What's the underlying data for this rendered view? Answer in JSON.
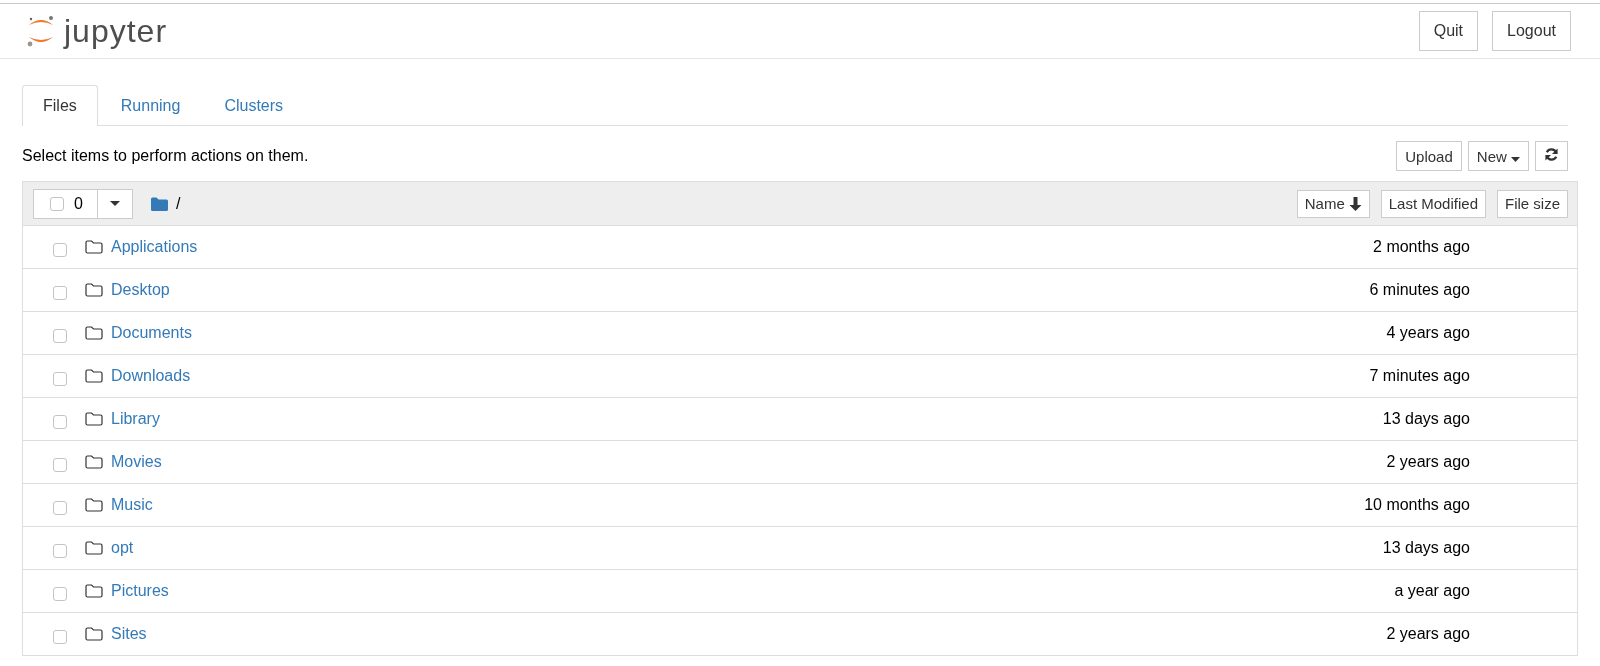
{
  "header": {
    "logo_text": "jupyter",
    "buttons": [
      "Quit",
      "Logout"
    ]
  },
  "tabs": [
    {
      "label": "Files",
      "selected": true
    },
    {
      "label": "Running",
      "selected": false
    },
    {
      "label": "Clusters",
      "selected": false
    }
  ],
  "toolbar": {
    "hint": "Select items to perform actions on them.",
    "buttons": [
      {
        "kind": "text",
        "label": "Upload"
      },
      {
        "kind": "dropdown",
        "label": "New"
      },
      {
        "kind": "refresh"
      }
    ]
  },
  "list_header": {
    "select_all_checked": false,
    "selected_count": "0",
    "path": "/",
    "sort_buttons": [
      {
        "label": "Name",
        "sorted": true
      },
      {
        "label": "Last Modified",
        "sorted": false
      },
      {
        "label": "File size",
        "sorted": false
      }
    ]
  },
  "rows": [
    {
      "name": "Applications",
      "modified": "2 months ago",
      "checked": false
    },
    {
      "name": "Desktop",
      "modified": "6 minutes ago",
      "checked": false
    },
    {
      "name": "Documents",
      "modified": "4 years ago",
      "checked": false
    },
    {
      "name": "Downloads",
      "modified": "7 minutes ago",
      "checked": false
    },
    {
      "name": "Library",
      "modified": "13 days ago",
      "checked": false
    },
    {
      "name": "Movies",
      "modified": "2 years ago",
      "checked": false
    },
    {
      "name": "Music",
      "modified": "10 months ago",
      "checked": false
    },
    {
      "name": "opt",
      "modified": "13 days ago",
      "checked": false
    },
    {
      "name": "Pictures",
      "modified": "a year ago",
      "checked": false
    },
    {
      "name": "Sites",
      "modified": "2 years ago",
      "checked": false
    }
  ]
}
